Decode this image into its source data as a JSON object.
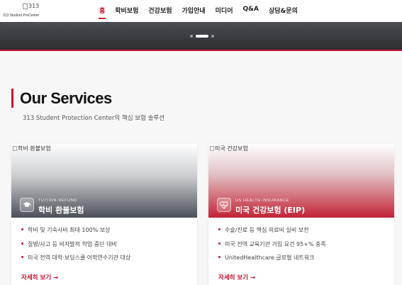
{
  "header": {
    "logo_alt": "313",
    "logo_text": "313 Student ProCenter",
    "nav": [
      {
        "label": "홈",
        "active": true
      },
      {
        "label": "학비보험",
        "active": false
      },
      {
        "label": "건강보험",
        "active": false
      },
      {
        "label": "가입안내",
        "active": false
      },
      {
        "label": "미디어",
        "active": false
      },
      {
        "label": "Q&A",
        "active": false
      },
      {
        "label": "상담&문의",
        "active": false
      }
    ]
  },
  "hero": {
    "slides": 3,
    "active_slide": 2
  },
  "section": {
    "title": "Our Services",
    "subtitle": "313 Student Protection Center의 핵심 보험 솔루션"
  },
  "cards": [
    {
      "image_alt": "학비 환불보험",
      "small_label": "TUITION REFUND",
      "title": "학비 환불보험",
      "icon": "graduation-cap-icon",
      "features": [
        "학비 및 기숙사비 최대 100% 보상",
        "질병/사고 등 비자발적 학업 중단 대비",
        "미국 전역 대학·보딩스쿨·어학연수기관 대상"
      ],
      "link": "자세히 보기 →"
    },
    {
      "image_alt": "미국 건강보험",
      "small_label": "US HEALTH INSURANCE",
      "title": "미국 건강보험 (EIP)",
      "icon": "heart-pulse-icon",
      "features": [
        "수술/진료 등 핵심 의료비 실비 보전",
        "미국 전역 교육기관 가입 요건 95+% 충족",
        "UnitedHealthcare 글로벌 네트워크"
      ],
      "link": "자세히 보기 →"
    }
  ],
  "colors": {
    "accent": "#c8102e",
    "hero_dark": "#2c2e32"
  }
}
